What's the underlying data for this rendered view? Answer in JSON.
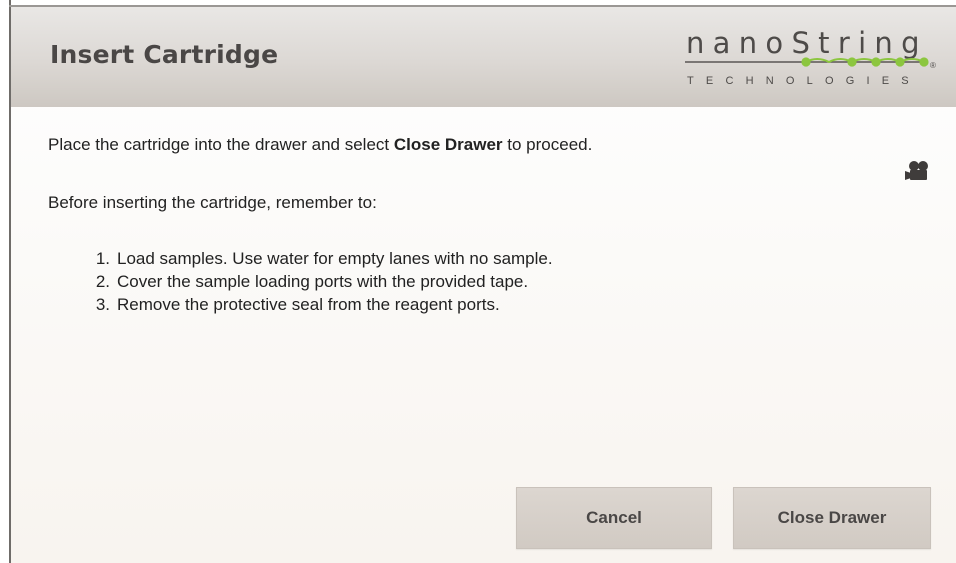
{
  "dialog": {
    "title": "Insert Cartridge"
  },
  "logo": {
    "wordmark": "nanoString",
    "subtitle": "TECHNOLOGIES",
    "registered": "®",
    "dot_color": "#8cc63f"
  },
  "instructions": {
    "line1_before": "Place the cartridge into the drawer and select ",
    "line1_bold": "Close Drawer",
    "line1_after": " to proceed.",
    "line2": "Before inserting the cartridge, remember to:",
    "steps": [
      {
        "number": "1.",
        "text": "Load samples. Use water for empty lanes with no sample."
      },
      {
        "number": "2.",
        "text": "Cover the sample loading ports with the provided tape."
      },
      {
        "number": "3.",
        "text": "Remove the protective seal from the reagent ports."
      }
    ]
  },
  "icons": {
    "video": "video-camera-icon"
  },
  "buttons": {
    "cancel": "Cancel",
    "close_drawer": "Close Drawer"
  },
  "colors": {
    "header_bg": "#dcd8d4",
    "button_bg": "#d5cec7",
    "title_text": "#4a4746",
    "body_text": "#222222"
  }
}
